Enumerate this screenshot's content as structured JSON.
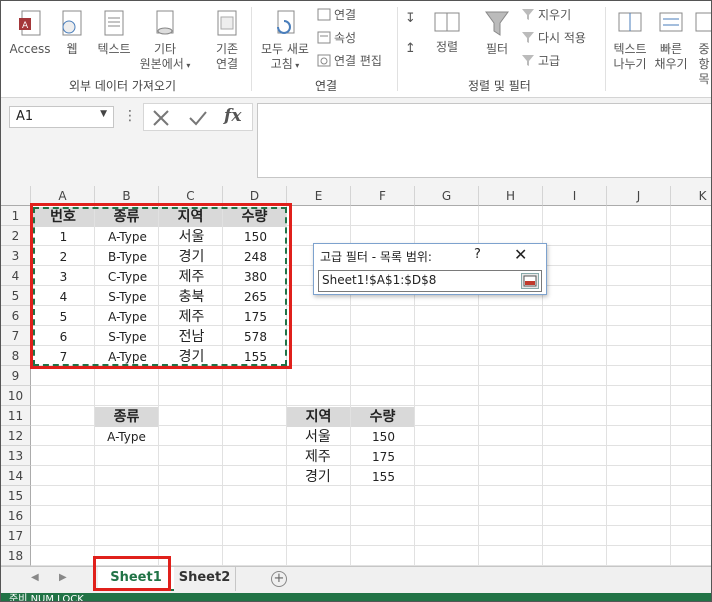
{
  "ribbon": {
    "get_external": {
      "access": "Access",
      "web": "웹",
      "text": "텍스트",
      "other_line1": "기타",
      "other_line2": "원본에서",
      "group_label": "외부 데이터 가져오기"
    },
    "existing": {
      "line1": "기존",
      "line2": "연결"
    },
    "connections": {
      "refresh_line1": "모두 새로",
      "refresh_line2": "고침",
      "connections": "연결",
      "properties": "속성",
      "edit_links": "연결 편집",
      "group_label": "연결"
    },
    "sort_filter": {
      "sort": "정렬",
      "filter": "필터",
      "clear": "지우기",
      "reapply": "다시 적용",
      "advanced": "고급",
      "group_label": "정렬 및 필터"
    },
    "data_tools": {
      "text_to_cols_line1": "텍스트",
      "text_to_cols_line2": "나누기",
      "flash_fill_line1": "빠른",
      "flash_fill_line2": "채우기",
      "remove_dup_line1": "중",
      "remove_dup_line2": "항목"
    }
  },
  "formula_bar": {
    "name_box": "A1",
    "dots": "⋮",
    "fx": "fx"
  },
  "columns": [
    "A",
    "B",
    "C",
    "D",
    "E",
    "F",
    "G",
    "H",
    "I",
    "J",
    "K"
  ],
  "rows": [
    "1",
    "2",
    "3",
    "4",
    "5",
    "6",
    "7",
    "8",
    "9",
    "10",
    "11",
    "12",
    "13",
    "14",
    "15",
    "16",
    "17",
    "18"
  ],
  "list_table": {
    "headers": [
      "번호",
      "종류",
      "지역",
      "수량"
    ],
    "rows": [
      [
        "1",
        "A-Type",
        "서울",
        "150"
      ],
      [
        "2",
        "B-Type",
        "경기",
        "248"
      ],
      [
        "3",
        "C-Type",
        "제주",
        "380"
      ],
      [
        "4",
        "S-Type",
        "충북",
        "265"
      ],
      [
        "5",
        "A-Type",
        "제주",
        "175"
      ],
      [
        "6",
        "S-Type",
        "전남",
        "578"
      ],
      [
        "7",
        "A-Type",
        "경기",
        "155"
      ]
    ]
  },
  "criteria": {
    "header": "종류",
    "value": "A-Type"
  },
  "result_table": {
    "headers": [
      "지역",
      "수량"
    ],
    "rows": [
      [
        "서울",
        "150"
      ],
      [
        "제주",
        "175"
      ],
      [
        "경기",
        "155"
      ]
    ]
  },
  "dialog": {
    "title": "고급 필터 - 목록 범위:",
    "help": "?",
    "close": "✕",
    "value": "Sheet1!$A$1:$D$8"
  },
  "sheet_tabs": {
    "tabs": [
      "Sheet1",
      "Sheet2"
    ],
    "add": "+"
  },
  "status": "준비    NUM LOCK",
  "colors": {
    "excel_green": "#217346",
    "highlight_red": "#e0201b",
    "header_fill": "#d9d9d9"
  }
}
